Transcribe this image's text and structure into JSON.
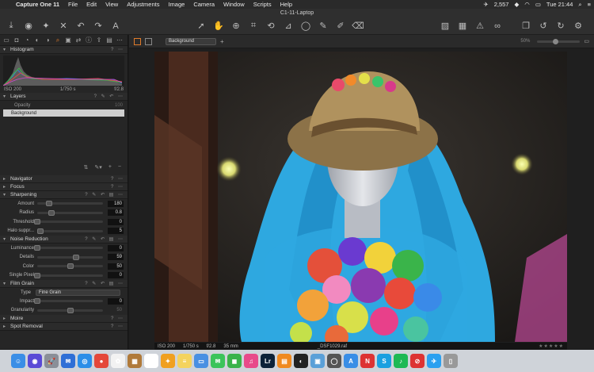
{
  "menubar": {
    "items": [
      "Capture One 11",
      "File",
      "Edit",
      "View",
      "Adjustments",
      "Image",
      "Camera",
      "Window",
      "Scripts",
      "Help"
    ],
    "twitter_count": "2,557",
    "clock": "Tue 21:44"
  },
  "window": {
    "title": "C1-11-Laptop"
  },
  "panel": {
    "histogram": {
      "title": "Histogram",
      "iso": "ISO 200",
      "shutter": "1/750 s",
      "aperture": "f/2.8"
    },
    "layers": {
      "title": "Layers",
      "opacity_label": "Opacity",
      "opacity_value": "100",
      "layer_name": "Background"
    },
    "navigator": "Navigator",
    "focus": "Focus",
    "sharpening": {
      "title": "Sharpening",
      "rows": [
        {
          "label": "Amount",
          "value": "180",
          "pos": 0.18
        },
        {
          "label": "Radius",
          "value": "0.8",
          "pos": 0.22
        },
        {
          "label": "Threshold",
          "value": "0",
          "pos": 0.0
        },
        {
          "label": "Halo suppr...",
          "value": "5",
          "pos": 0.05
        }
      ]
    },
    "noise": {
      "title": "Noise Reduction",
      "rows": [
        {
          "label": "Luminance",
          "value": "0",
          "pos": 0.0
        },
        {
          "label": "Details",
          "value": "59",
          "pos": 0.59
        },
        {
          "label": "Color",
          "value": "50",
          "pos": 0.5
        },
        {
          "label": "Single Pixel",
          "value": "0",
          "pos": 0.0
        }
      ]
    },
    "film_grain": {
      "title": "Film Grain",
      "type_label": "Type",
      "type_value": "Fine Grain",
      "rows": [
        {
          "label": "Impact",
          "value": "0",
          "pos": 0.0
        },
        {
          "label": "Granularity",
          "value": "50",
          "pos": 0.5
        }
      ]
    },
    "moire": "Moire",
    "spot_removal": "Spot Removal"
  },
  "viewer": {
    "layer_select": "Background",
    "zoom": "50%",
    "status": {
      "iso": "ISO 200",
      "shutter": "1/750 s",
      "aperture": "f/2.8",
      "focal": "35 mm",
      "filename": "_DSF1029.raf",
      "stars": "★★★★★"
    }
  },
  "colors": {
    "accent": "#e07b2a",
    "wig": "#2ea8e0",
    "background": "#1b1b1b"
  },
  "dock": {
    "icons": [
      {
        "name": "finder",
        "color": "#3a8ee6",
        "glyph": "☺"
      },
      {
        "name": "siri",
        "color": "#5a4ad6",
        "glyph": "◉"
      },
      {
        "name": "launchpad",
        "color": "#8a8f98",
        "glyph": "🚀"
      },
      {
        "name": "mail-app",
        "color": "#2f6fd6",
        "glyph": "✉"
      },
      {
        "name": "safari",
        "color": "#2c8ee8",
        "glyph": "◎"
      },
      {
        "name": "chrome",
        "color": "#e4483a",
        "glyph": "●"
      },
      {
        "name": "photos",
        "color": "#f2f2f2",
        "glyph": "✿"
      },
      {
        "name": "notes",
        "color": "#b07a3a",
        "glyph": "▦"
      },
      {
        "name": "calendar",
        "color": "#ffffff",
        "glyph": "24"
      },
      {
        "name": "butterfly",
        "color": "#f0a020",
        "glyph": "✦"
      },
      {
        "name": "notes-yellow",
        "color": "#f4d35e",
        "glyph": "≡"
      },
      {
        "name": "folder",
        "color": "#4a90e2",
        "glyph": "▭"
      },
      {
        "name": "messages",
        "color": "#3ac45a",
        "glyph": "✉"
      },
      {
        "name": "facetime",
        "color": "#3ab34a",
        "glyph": "◼"
      },
      {
        "name": "itunes",
        "color": "#e84a8a",
        "glyph": "♫"
      },
      {
        "name": "lightroom",
        "color": "#0c2238",
        "glyph": "Lr"
      },
      {
        "name": "ibooks",
        "color": "#f08a20",
        "glyph": "▤"
      },
      {
        "name": "photo-editor",
        "color": "#222",
        "glyph": "◐"
      },
      {
        "name": "preview",
        "color": "#5aa0d8",
        "glyph": "▣"
      },
      {
        "name": "capture-one",
        "color": "#555",
        "glyph": "◯"
      },
      {
        "name": "app-store",
        "color": "#3a8ee6",
        "glyph": "A"
      },
      {
        "name": "news",
        "color": "#d33",
        "glyph": "N"
      },
      {
        "name": "skype",
        "color": "#1aa0e0",
        "glyph": "S"
      },
      {
        "name": "spotify",
        "color": "#1db954",
        "glyph": "♪"
      },
      {
        "name": "blocked",
        "color": "#d33",
        "glyph": "⊘"
      },
      {
        "name": "twitter",
        "color": "#2aa0f0",
        "glyph": "✈"
      },
      {
        "name": "trash",
        "color": "#999",
        "glyph": "▯"
      }
    ]
  }
}
